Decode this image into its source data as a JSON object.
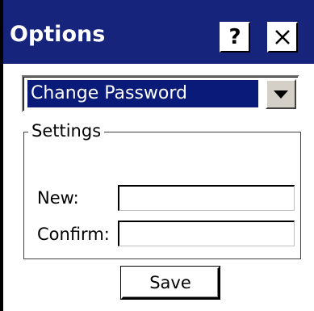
{
  "window": {
    "title": "Options",
    "help_label": "?",
    "titlebar_color": "#16247c"
  },
  "dropdown": {
    "selected": "Change Password",
    "highlight_color": "#0a1a78"
  },
  "settings": {
    "group_label": "Settings",
    "new_label": "New:",
    "new_value": "",
    "confirm_label": "Confirm:",
    "confirm_value": ""
  },
  "actions": {
    "save_label": "Save"
  },
  "icons": {
    "help": "help-icon",
    "close": "close-icon",
    "dropdown": "dropdown-arrow-icon"
  }
}
